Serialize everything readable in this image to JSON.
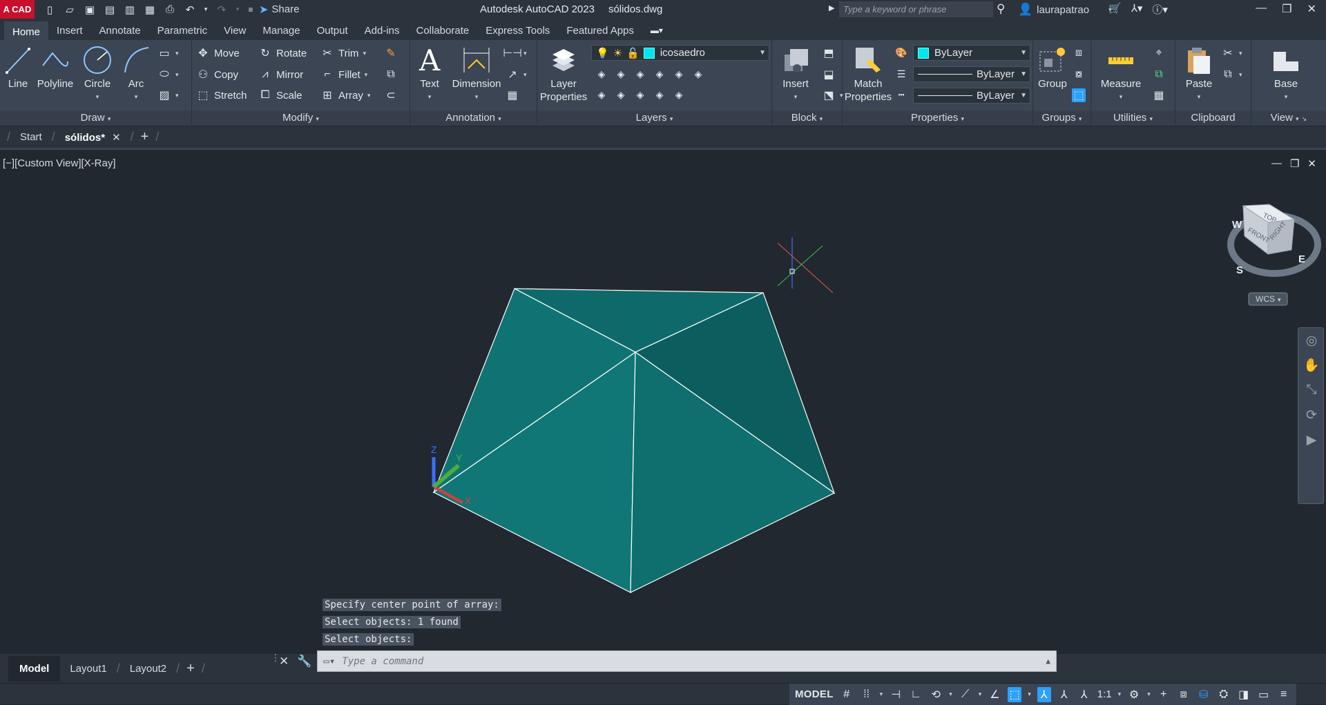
{
  "titlebar": {
    "app_logo": "A CAD",
    "share_label": "Share",
    "app_name": "Autodesk AutoCAD 2023",
    "file_name": "sólidos.dwg",
    "search_placeholder": "Type a keyword or phrase",
    "user_name": "laurapatrao"
  },
  "ribbon_tabs": [
    "Home",
    "Insert",
    "Annotate",
    "Parametric",
    "View",
    "Manage",
    "Output",
    "Add-ins",
    "Collaborate",
    "Express Tools",
    "Featured Apps"
  ],
  "ribbon": {
    "draw": {
      "title": "Draw",
      "line": "Line",
      "polyline": "Polyline",
      "circle": "Circle",
      "arc": "Arc"
    },
    "modify": {
      "title": "Modify",
      "move": "Move",
      "rotate": "Rotate",
      "trim": "Trim",
      "copy": "Copy",
      "mirror": "Mirror",
      "fillet": "Fillet",
      "stretch": "Stretch",
      "scale": "Scale",
      "array": "Array"
    },
    "annotation": {
      "title": "Annotation",
      "text": "Text",
      "dimension": "Dimension"
    },
    "layers": {
      "title": "Layers",
      "layer_properties_1": "Layer",
      "layer_properties_2": "Properties",
      "current_layer": "icosaedro",
      "layer_color": "#00e5ee"
    },
    "block": {
      "title": "Block",
      "insert": "Insert"
    },
    "properties": {
      "title": "Properties",
      "match_1": "Match",
      "match_2": "Properties",
      "color": "ByLayer",
      "lineweight": "ByLayer",
      "linetype": "ByLayer"
    },
    "groups": {
      "title": "Groups",
      "group": "Group"
    },
    "utilities": {
      "title": "Utilities",
      "measure": "Measure"
    },
    "clipboard": {
      "title": "Clipboard",
      "paste": "Paste"
    },
    "view": {
      "title": "View",
      "base": "Base"
    }
  },
  "doc_tabs": {
    "start": "Start",
    "active": "sólidos*"
  },
  "viewport": {
    "label": "[−][Custom View][X-Ray]",
    "viewcube": {
      "top": "TOP",
      "front": "FRONT",
      "right": "RIGHT",
      "w": "W",
      "s": "S",
      "e": "E",
      "wcs": "WCS"
    },
    "ucs": {
      "x": "X",
      "y": "Y",
      "z": "Z"
    },
    "solid_fill": "#0f7070"
  },
  "command_history": [
    "Specify center point of array:",
    "Select objects: 1 found",
    "Select objects:"
  ],
  "command_input_placeholder": "Type a command",
  "layout_tabs": [
    "Model",
    "Layout1",
    "Layout2"
  ],
  "status": {
    "model": "MODEL",
    "scale": "1:1"
  }
}
